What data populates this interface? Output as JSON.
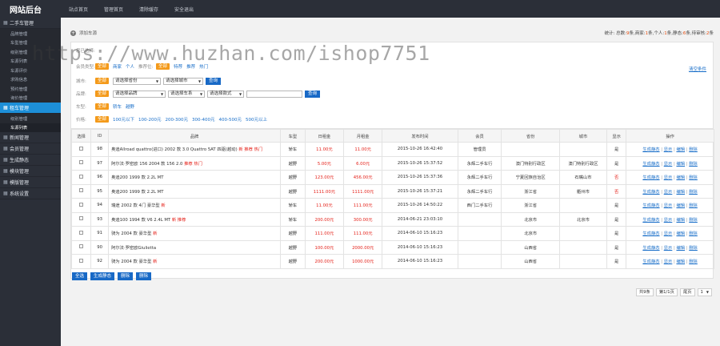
{
  "app": {
    "title": "网站后台"
  },
  "topnav": [
    "站点首页",
    "管理首页",
    "清除缓存",
    "安全退出"
  ],
  "sidebar": [
    {
      "label": "二手车管理",
      "active": false,
      "icon": "grid-icon",
      "subs": [
        "品牌管理",
        "车型管理",
        "级别管理",
        "车源列表",
        "车源评价",
        "求购信息",
        "预约管理",
        "询价管理"
      ]
    },
    {
      "label": "租车管理",
      "active": true,
      "icon": "grid-icon",
      "subs": [
        "级别管理",
        "车源列表"
      ]
    },
    {
      "label": "新闻管理",
      "icon": "grid-icon"
    },
    {
      "label": "会员管理",
      "icon": "grid-icon"
    },
    {
      "label": "生成静态",
      "icon": "grid-icon"
    },
    {
      "label": "模块管理",
      "icon": "grid-icon"
    },
    {
      "label": "模版管理",
      "icon": "grid-icon"
    },
    {
      "label": "系统设置",
      "icon": "grid-icon"
    }
  ],
  "crumb": {
    "text": "添加车源"
  },
  "stats": {
    "prefix": "统计: 总数:",
    "total": "9",
    "t1": "条,商家:",
    "biz": "1",
    "t2": "条,个人:",
    "personal": "1",
    "t3": "条,静态:",
    "static": "6",
    "t4": "条,待审核:",
    "pending": "2",
    "t5": "条"
  },
  "watermark": "https://www.huzhan.com/ishop7751",
  "filters": {
    "selected_label": "您已选择:",
    "wipe": "清空条件",
    "member_label": "会员类型:",
    "all": "全部",
    "member_opts": [
      "商家",
      "个人"
    ],
    "recommend_label": "推荐位:",
    "recommend_opts": [
      "特荐",
      "推荐",
      "热门"
    ],
    "city_label": "城市:",
    "city_sel1": "请选择省份",
    "city_sel2": "请选择城市",
    "query": "查询",
    "brand_label": "品牌:",
    "brand_sel1": "请选择品牌",
    "brand_sel2": "请选择车系",
    "brand_sel3": "请选择款式",
    "cartype_label": "车型:",
    "cartype_opts": [
      "轿车",
      "越野"
    ],
    "price_label": "价格:",
    "price_opts": [
      "100元以下",
      "100-200元",
      "200-300元",
      "300-400元",
      "400-500元",
      "500元以上"
    ]
  },
  "table": {
    "headers": [
      "选择",
      "ID",
      "品牌",
      "车型",
      "日租金",
      "月租金",
      "发布时间",
      "会员",
      "省份",
      "城市",
      "显示",
      "操作"
    ],
    "actions": [
      "生成静态",
      "显示",
      "编辑",
      "删除"
    ],
    "rows": [
      {
        "id": "98",
        "brand": "奥迪Allroad quattro(进口) 2002 款 3.0 Quattro 5AT 四驱(越动)",
        "tags": "新 推荐 热门",
        "type": "轿车",
        "day": "11.00元",
        "month": "11.00元",
        "time": "2015-10-26 16:42:40",
        "member": "管理员",
        "prov": "",
        "city": "",
        "show": "是"
      },
      {
        "id": "97",
        "brand": "阿尔法·罗密欧 156 2004 款 156 2.0",
        "tags": "推荐 热门",
        "type": "越野",
        "day": "5.00元",
        "month": "6.00元",
        "time": "2015-10-26 15:37:52",
        "member": "永辉二手车行",
        "prov": "澳门特别行政区",
        "city": "澳门特别行政区",
        "show": "是"
      },
      {
        "id": "96",
        "brand": "奥迪200 1999 款 2.2L MT",
        "tags": "",
        "type": "越野",
        "day": "123.00元",
        "month": "456.00元",
        "time": "2015-10-26 15:37:36",
        "member": "永辉二手车行",
        "prov": "宁夏回族自治区",
        "city": "石嘴山市",
        "show": "否"
      },
      {
        "id": "95",
        "brand": "奥迪200 1999 款 2.2L MT",
        "tags": "",
        "type": "越野",
        "day": "1111.00元",
        "month": "1111.00元",
        "time": "2015-10-26 15:37:21",
        "member": "永辉二手车行",
        "prov": "浙江省",
        "city": "衢州市",
        "show": "否"
      },
      {
        "id": "94",
        "brand": "瑞途 2002 款 4门 豪华型",
        "tags": "新",
        "type": "轿车",
        "day": "11.00元",
        "month": "111.00元",
        "time": "2015-10-26 14:50:22",
        "member": "西门二手车行",
        "prov": "浙江省",
        "city": "",
        "show": "是"
      },
      {
        "id": "93",
        "brand": "奥迪100 1994 款 V6 2.4L MT",
        "tags": "新 推荐",
        "type": "轿车",
        "day": "200.00元",
        "month": "300.00元",
        "time": "2014-06-21 23:03:10",
        "member": "",
        "prov": "北京市",
        "city": "北京市",
        "show": "是"
      },
      {
        "id": "91",
        "brand": "骑为 2004 款 豪华型",
        "tags": "新",
        "type": "越野",
        "day": "111.00元",
        "month": "111.00元",
        "time": "2014-06-10 15:16:23",
        "member": "",
        "prov": "北京市",
        "city": "",
        "show": "是"
      },
      {
        "id": "90",
        "brand": "阿尔法·罗密欧Giulietta",
        "tags": "",
        "type": "越野",
        "day": "100.00元",
        "month": "2000.00元",
        "time": "2014-06-10 15:16:23",
        "member": "",
        "prov": "山西省",
        "city": "",
        "show": "是"
      },
      {
        "id": "92",
        "brand": "骑为 2004 款 豪华型",
        "tags": "新",
        "type": "越野",
        "day": "200.00元",
        "month": "1000.00元",
        "time": "2014-06-10 15:16:23",
        "member": "",
        "prov": "山西省",
        "city": "",
        "show": "是"
      }
    ]
  },
  "bulk": [
    "全选",
    "生成静态",
    "删除",
    "删除"
  ],
  "pager": {
    "count": "共9条",
    "page": "第1/1页",
    "last": "尾页",
    "sel": "1"
  }
}
